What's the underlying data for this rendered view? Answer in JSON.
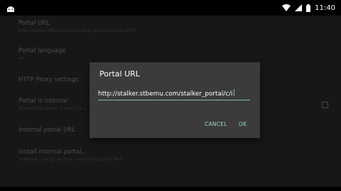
{
  "status_bar": {
    "time": "11:40",
    "left_icon": "android-debug-icon",
    "icons": [
      "wifi-icon",
      "signal-icon",
      "battery-icon"
    ]
  },
  "settings": {
    "items": [
      {
        "title": "Portal URL",
        "summary": "http://stalker.stbemu.com/stalker_portal/c/index.html"
      },
      {
        "title": "Portal language",
        "summary": "en"
      },
      {
        "title": "HTTP Proxy settings",
        "summary": ""
      },
      {
        "title": "Portal is internal",
        "summary": "Enable this option if portal is s..."
      },
      {
        "title": "Internal portal URL",
        "summary": ""
      },
      {
        "title": "Install internal portal...",
        "summary": "Selected a tar.gz archive containing portal files"
      }
    ]
  },
  "dialog": {
    "title": "Portal URL",
    "input_value": "http://stalker.stbemu.com/stalker_portal/c/i",
    "cancel_label": "CANCEL",
    "ok_label": "OK",
    "accent_color": "#8fd3c4"
  }
}
